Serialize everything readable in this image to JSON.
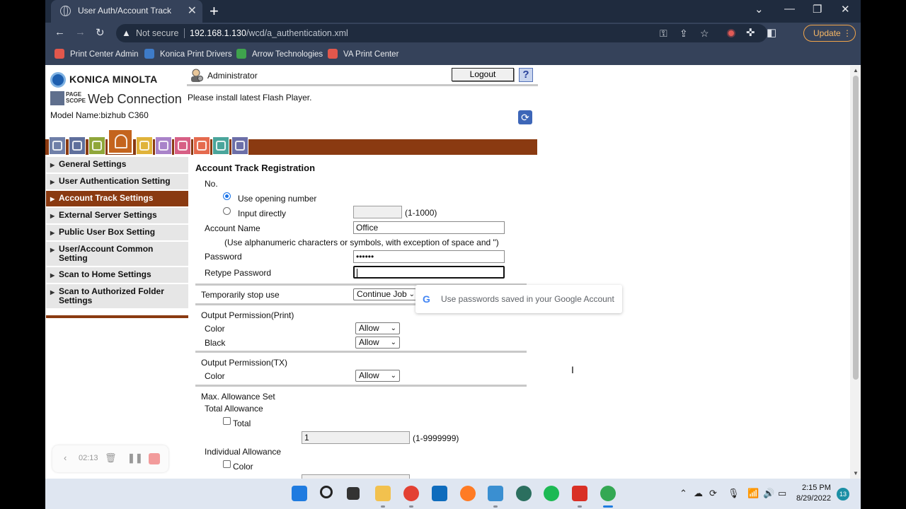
{
  "browser": {
    "tab_title": "User Auth/Account Track",
    "tab_close": "✕",
    "new_tab": "+",
    "security_label": "Not secure",
    "url_host": "192.168.1.130",
    "url_path": "/wcd/a_authentication.xml",
    "update_label": "Update ⋮",
    "bookmarks": [
      "Print Center Admin",
      "Konica Print Drivers",
      "Arrow Technologies",
      "VA Print Center"
    ]
  },
  "header": {
    "brand": "KONICA MINOLTA",
    "pagescope_top": "PAGE",
    "pagescope_bottom": "SCOPE",
    "product": "Web Connection",
    "model": "Model Name:bizhub C360",
    "user_role": "Administrator",
    "logout_label": "Logout",
    "help_label": "?",
    "flash_notice": "Please install latest Flash Player."
  },
  "sidebar": {
    "items": [
      {
        "label": "General Settings",
        "active": false
      },
      {
        "label": "User Authentication Setting",
        "active": false
      },
      {
        "label": "Account Track Settings",
        "active": true
      },
      {
        "label": "External Server Settings",
        "active": false
      },
      {
        "label": "Public User Box Setting",
        "active": false
      },
      {
        "label": "User/Account Common Setting",
        "active": false
      },
      {
        "label": "Scan to Home Settings",
        "active": false
      },
      {
        "label": "Scan to Authorized Folder Settings",
        "active": false
      }
    ]
  },
  "form": {
    "title": "Account Track Registration",
    "no_label": "No.",
    "opt_opening": "Use opening number",
    "opt_direct": "Input directly",
    "direct_range": "(1-1000)",
    "direct_value": "",
    "name_label": "Account Name",
    "name_value": "Office",
    "name_hint": "(Use alphanumeric characters or symbols, with exception of space and \")",
    "password_label": "Password",
    "password_value": "••••••",
    "retype_label": "Retype Password",
    "retype_value": "",
    "stop_label": "Temporarily stop use",
    "stop_value": "Continue Job",
    "print_perm_label": "Output Permission(Print)",
    "print_color_label": "Color",
    "print_color_value": "Allow",
    "print_black_label": "Black",
    "print_black_value": "Allow",
    "tx_perm_label": "Output Permission(TX)",
    "tx_color_label": "Color",
    "tx_color_value": "Allow",
    "max_label": "Max. Allowance Set",
    "total_allow_label": "Total Allowance",
    "total_chk_label": "Total",
    "total_value": "1",
    "total_range": "(1-9999999)",
    "indiv_label": "Individual Allowance",
    "indiv_color_label": "Color"
  },
  "autofill": {
    "text": "Use passwords saved in your Google Account",
    "logo": "G"
  },
  "recorder": {
    "time": "02:13"
  },
  "taskbar": {
    "time": "2:15 PM",
    "date": "8/29/2022",
    "badge": "13"
  }
}
